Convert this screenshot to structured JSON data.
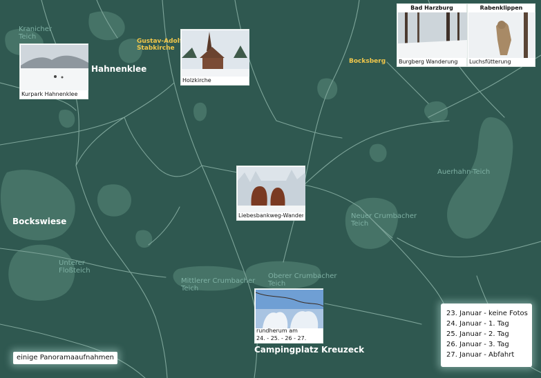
{
  "map": {
    "colors": {
      "background": "#2f5850",
      "lake": "#467367",
      "road": "#7ea59a",
      "lake_label": "#7fb1a4",
      "highlight_label": "#f2c84a"
    },
    "lake_labels": {
      "kranicher_teich": "Kranicher\nTeich",
      "auerhahn_teich": "Auerhahn-Teich",
      "neuer_crumbacher_teich": "Neuer Crumbacher\nTeich",
      "unterer_flossteich": "Unterer\nFloßteich",
      "mittlerer_crumbacher_teich": "Mittlerer Crumbacher\nTeich",
      "oberer_crumbacher_teich": "Oberer Crumbacher\nTeich"
    },
    "place_labels": {
      "hahnenklee": "Hahnenklee",
      "bockswiese": "Bockswiese",
      "campingplatz": "Campingplatz Kreuzeck",
      "stabkirche": "Gustav-Adolf\nStabkirche",
      "bocksberg": "Bocksberg"
    },
    "photos": {
      "kurpark": {
        "caption": "Kurpark Hahnenklee",
        "icon": "snowy-park-photo"
      },
      "holzkirche": {
        "caption": "Holzkirche",
        "icon": "stave-church-photo"
      },
      "harzburg": {
        "title": "Bad Harzburg",
        "caption": "Burgberg Wanderung",
        "icon": "forest-path-photo"
      },
      "lynx": {
        "title": "Rabenklippen",
        "caption": "Luchsfütterung",
        "icon": "lynx-photo"
      },
      "liebesbank": {
        "caption": "Liebesbankweg-Wanderung",
        "icon": "bench-figures-photo"
      },
      "rundherum": {
        "caption_line1": "rundherum am",
        "caption_line2": "24. - 25. - 26 - 27.",
        "icon": "snowy-trees-photo"
      }
    },
    "legend": [
      "23. Januar - keine Fotos",
      "24. Januar - 1. Tag",
      "25. Januar - 2. Tag",
      "26. Januar - 3. Tag",
      "27. Januar - Abfahrt"
    ],
    "panorama_button": "einige Panoramaaufnahmen"
  }
}
